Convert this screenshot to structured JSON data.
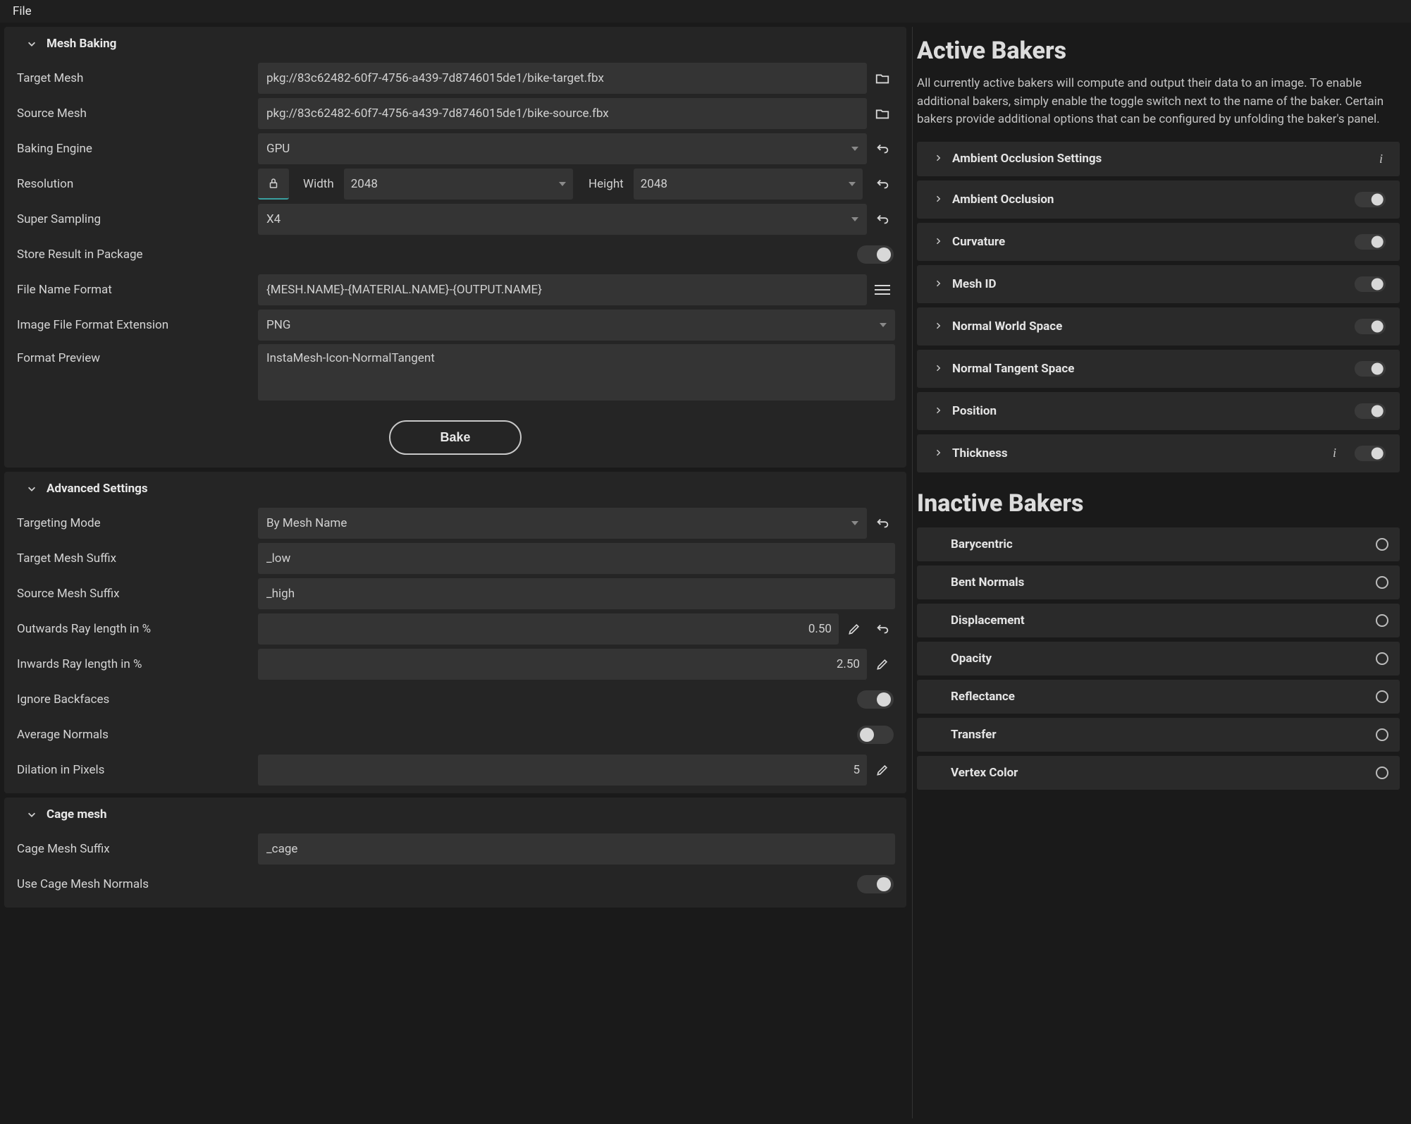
{
  "menubar": {
    "file": "File"
  },
  "meshBaking": {
    "title": "Mesh Baking",
    "targetMeshLabel": "Target Mesh",
    "targetMesh": "pkg://83c62482-60f7-4756-a439-7d8746015de1/bike-target.fbx",
    "sourceMeshLabel": "Source Mesh",
    "sourceMesh": "pkg://83c62482-60f7-4756-a439-7d8746015de1/bike-source.fbx",
    "bakingEngineLabel": "Baking Engine",
    "bakingEngine": "GPU",
    "resolutionLabel": "Resolution",
    "widthLabel": "Width",
    "width": "2048",
    "heightLabel": "Height",
    "height": "2048",
    "superSamplingLabel": "Super Sampling",
    "superSampling": "X4",
    "storeResultLabel": "Store Result in Package",
    "fileNameFormatLabel": "File Name Format",
    "fileNameFormat": "{MESH.NAME}-{MATERIAL.NAME}-{OUTPUT.NAME}",
    "imageFormatLabel": "Image File Format Extension",
    "imageFormat": "PNG",
    "formatPreviewLabel": "Format Preview",
    "formatPreview": "InstaMesh-Icon-NormalTangent",
    "bakeButton": "Bake"
  },
  "advanced": {
    "title": "Advanced Settings",
    "targetingModeLabel": "Targeting Mode",
    "targetingMode": "By Mesh Name",
    "targetSuffixLabel": "Target Mesh Suffix",
    "targetSuffix": "_low",
    "sourceSuffixLabel": "Source Mesh Suffix",
    "sourceSuffix": "_high",
    "outwardsLabel": "Outwards Ray length in %",
    "outwards": "0.50",
    "inwardsLabel": "Inwards Ray length in %",
    "inwards": "2.50",
    "ignoreBackfacesLabel": "Ignore Backfaces",
    "avgNormalsLabel": "Average Normals",
    "dilationLabel": "Dilation in Pixels",
    "dilation": "5"
  },
  "cage": {
    "title": "Cage mesh",
    "suffixLabel": "Cage Mesh Suffix",
    "suffix": "_cage",
    "useNormalsLabel": "Use Cage Mesh Normals"
  },
  "active": {
    "title": "Active Bakers",
    "desc": "All currently active bakers will compute and output their data to an image. To enable additional bakers, simply enable the toggle switch next to the name of the baker. Certain bakers provide additional options that can be configured by unfolding the baker's panel.",
    "items": [
      "Ambient Occlusion Settings",
      "Ambient Occlusion",
      "Curvature",
      "Mesh ID",
      "Normal World Space",
      "Normal Tangent Space",
      "Position",
      "Thickness"
    ]
  },
  "inactive": {
    "title": "Inactive Bakers",
    "items": [
      "Barycentric",
      "Bent Normals",
      "Displacement",
      "Opacity",
      "Reflectance",
      "Transfer",
      "Vertex Color"
    ]
  }
}
